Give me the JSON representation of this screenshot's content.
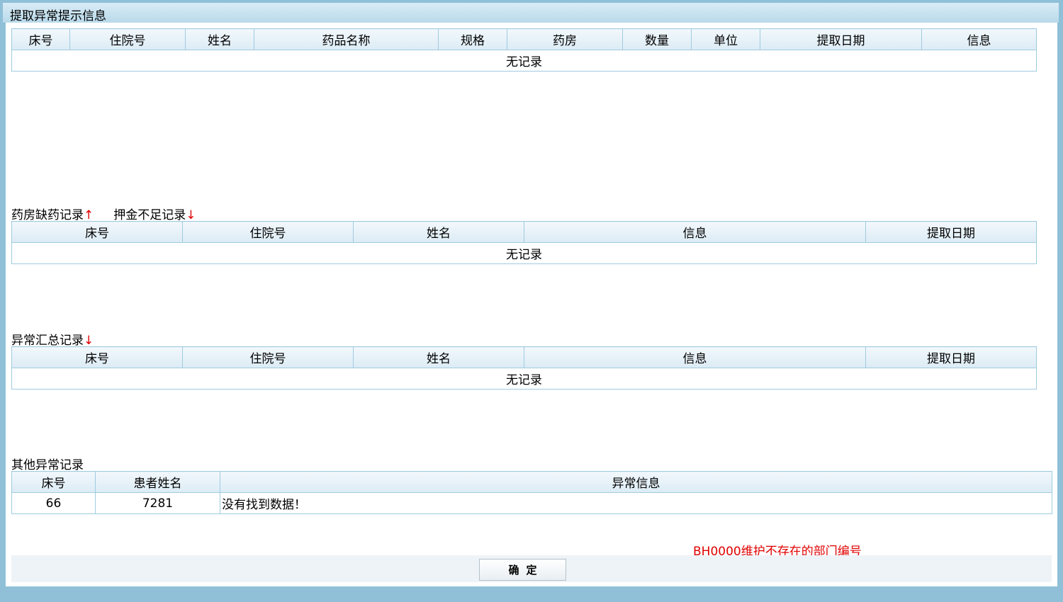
{
  "window": {
    "title": "提取异常提示信息"
  },
  "table1": {
    "headers": [
      "床号",
      "住院号",
      "姓名",
      "药品名称",
      "规格",
      "药房",
      "数量",
      "单位",
      "提取日期",
      "信息"
    ],
    "empty_text": "无记录"
  },
  "section2": {
    "label_a": "药房缺药记录",
    "arrow_a": "↑",
    "label_b": "押金不足记录",
    "arrow_b": "↓",
    "headers": [
      "床号",
      "住院号",
      "姓名",
      "信息",
      "提取日期"
    ],
    "empty_text": "无记录"
  },
  "section3": {
    "label": "异常汇总记录",
    "arrow": "↓",
    "headers": [
      "床号",
      "住院号",
      "姓名",
      "信息",
      "提取日期"
    ],
    "empty_text": "无记录"
  },
  "section4": {
    "label": "其他异常记录",
    "headers": [
      "床号",
      "患者姓名",
      "异常信息"
    ],
    "rows": [
      {
        "bed": "66",
        "patient": "7281",
        "message": "没有找到数据！"
      }
    ]
  },
  "note": "BH0000维护不存在的部门编号",
  "confirm_label": "确定",
  "colors": {
    "accent_red": "#e00000",
    "frame_blue": "#8fc0d8",
    "border_blue": "#9fcbe0"
  }
}
